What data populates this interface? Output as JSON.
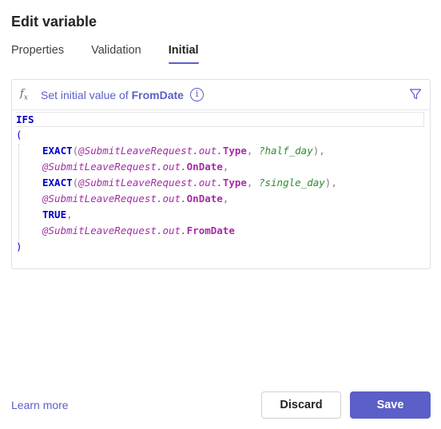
{
  "dialog": {
    "title": "Edit variable"
  },
  "tabs": [
    {
      "label": "Properties"
    },
    {
      "label": "Validation"
    },
    {
      "label": "Initial",
      "active": true
    }
  ],
  "editor": {
    "header_prefix": "Set initial value of ",
    "variable_name": "FromDate",
    "icons": [
      "fx-icon",
      "info-icon",
      "filter-icon"
    ],
    "code": {
      "fn": "IFS",
      "open": "(",
      "close": ")",
      "exact": "EXACT",
      "var": "@SubmitLeaveRequest",
      "out": ".out.",
      "type": "Type",
      "on_date": "OnDate",
      "from_date": "FromDate",
      "half_day": "?half_day",
      "single_day": "?single_day",
      "true_kw": "TRUE",
      "comma": ","
    }
  },
  "footer": {
    "learn_more": "Learn more",
    "discard": "Discard",
    "save": "Save"
  },
  "colors": {
    "accent": "#5b5fc7",
    "keyword": "#0000cc",
    "variable": "#a52da5",
    "string": "#2e8b2e"
  }
}
